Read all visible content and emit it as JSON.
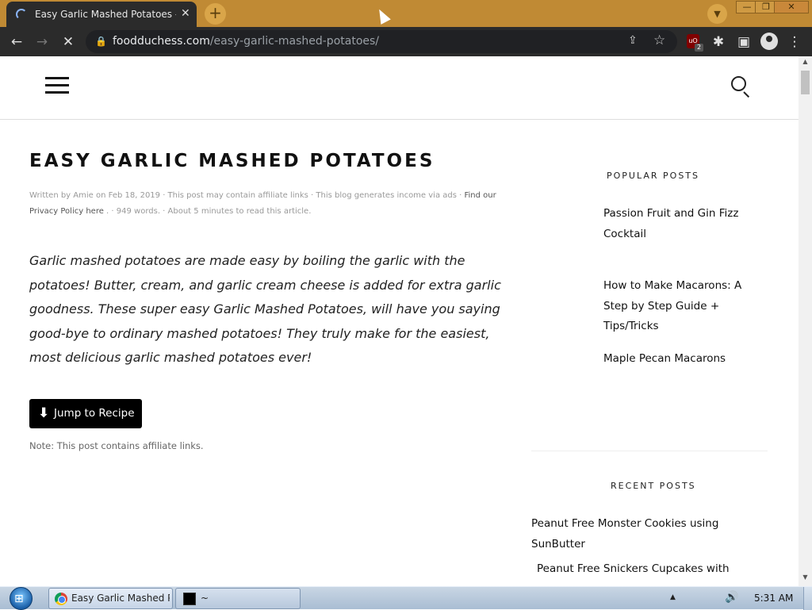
{
  "browser": {
    "tab_title": "Easy Garlic Mashed Potatoes - Fo",
    "tab_close": "✕",
    "new_tab": "+",
    "url_domain": "foodduchess.com",
    "url_path": "/easy-garlic-mashed-potatoes/",
    "extension_badge": "2",
    "extension_label": "uO",
    "window_min": "—",
    "window_max": "❐",
    "window_close": "✕",
    "icons": [
      "back-icon",
      "forward-icon",
      "stop-loading-icon",
      "lock-icon",
      "share-icon",
      "star-icon",
      "ublock-icon",
      "extensions-icon",
      "side-panel-icon",
      "profile-icon",
      "menu-icon"
    ]
  },
  "header": {
    "menu_icon": "hamburger-menu-icon",
    "search_icon": "search-icon"
  },
  "post": {
    "title": "EASY GARLIC MASHED POTATOES",
    "meta_line1_prefix": "Written by Amie on Feb 18, 2019 · This post may contain affiliate links · This blog generates income via ads · ",
    "meta_find_link": "Find our",
    "meta_privacy_link": "Privacy Policy here",
    "meta_line2_suffix": " . · 949 words. · About 5 minutes to read this article.",
    "intro": "Garlic mashed potatoes are made easy by boiling the garlic with the potatoes! Butter, cream, and garlic cream cheese is added for extra garlic goodness. These super easy Garlic Mashed Potatoes, will have you saying good-bye to ordinary mashed potatoes! They truly make for the easiest, most delicious garlic mashed potatoes ever!",
    "jump_button": "Jump to Recipe",
    "note": "Note: This post contains affiliate links."
  },
  "sidebar": {
    "popular_heading": "POPULAR POSTS",
    "popular_posts": [
      " Passion Fruit and Gin Fizz Cocktail",
      " How to Make Macarons: A Step by Step Guide + Tips/Tricks",
      " Maple Pecan Macarons"
    ],
    "recent_heading": "RECENT POSTS",
    "recent_posts": [
      " Peanut Free Monster Cookies using SunButter",
      "Peanut Free Snickers Cupcakes with"
    ]
  },
  "taskbar": {
    "chrome_task": "Easy Garlic Mashed P...",
    "terminal_task": "~",
    "clock": "5:31 AM",
    "tray_arrow": "▲",
    "volume_icon": "🔊"
  }
}
